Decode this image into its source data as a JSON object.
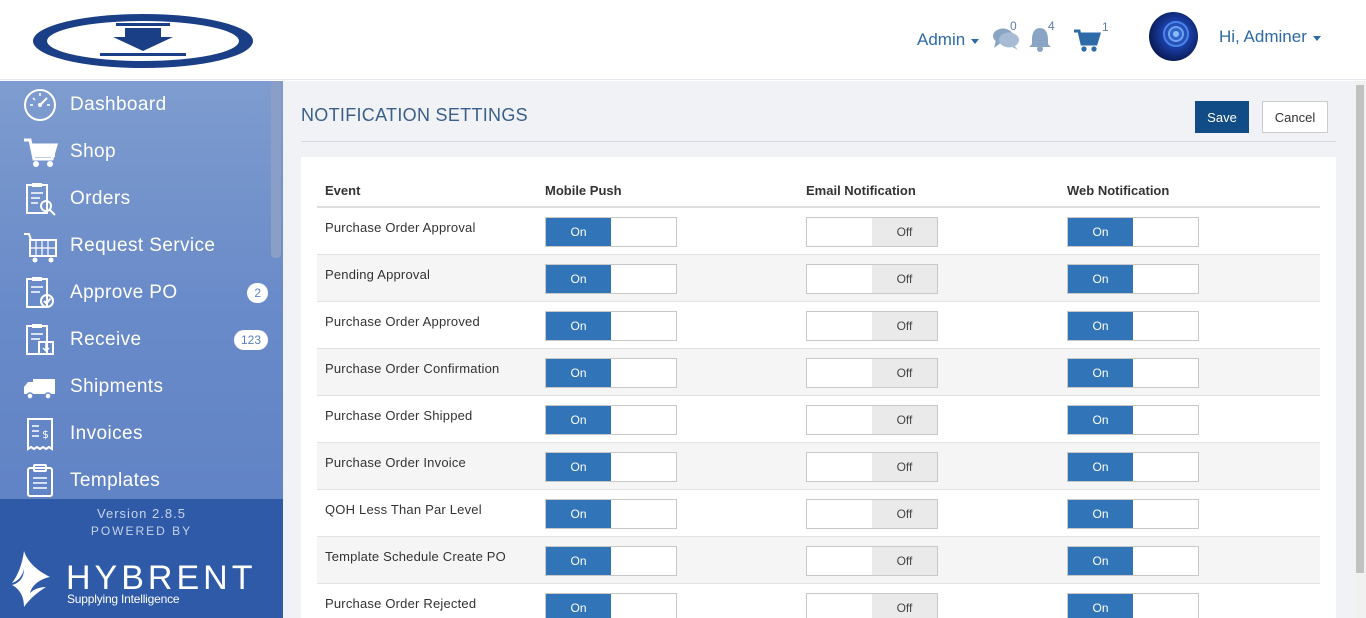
{
  "header": {
    "admin_menu": "Admin",
    "messages_count": "0",
    "notifications_count": "4",
    "cart_count": "1",
    "greeting": "Hi, Adminer"
  },
  "sidebar": {
    "items": [
      {
        "label": "Dashboard",
        "icon": "dashboard-icon"
      },
      {
        "label": "Shop",
        "icon": "cart-icon"
      },
      {
        "label": "Orders",
        "icon": "orders-icon"
      },
      {
        "label": "Request Service",
        "icon": "request-service-icon"
      },
      {
        "label": "Approve PO",
        "icon": "approve-po-icon",
        "badge": "2"
      },
      {
        "label": "Receive",
        "icon": "receive-icon",
        "badge": "123"
      },
      {
        "label": "Shipments",
        "icon": "truck-icon"
      },
      {
        "label": "Invoices",
        "icon": "invoice-icon"
      },
      {
        "label": "Templates",
        "icon": "clipboard-icon"
      }
    ],
    "version": "Version 2.8.5",
    "powered_by": "POWERED BY",
    "brand_name": "HYBRENT",
    "brand_tagline": "Supplying Intelligence"
  },
  "page": {
    "title": "NOTIFICATION SETTINGS",
    "save_label": "Save",
    "cancel_label": "Cancel"
  },
  "table": {
    "columns": [
      "Event",
      "Mobile Push",
      "Email Notification",
      "Web Notification"
    ],
    "on_label": "On",
    "off_label": "Off",
    "rows": [
      {
        "event": "Purchase Order Approval",
        "mobile": "On",
        "email": "Off",
        "web": "On"
      },
      {
        "event": "Pending Approval",
        "mobile": "On",
        "email": "Off",
        "web": "On"
      },
      {
        "event": "Purchase Order Approved",
        "mobile": "On",
        "email": "Off",
        "web": "On"
      },
      {
        "event": "Purchase Order Confirmation",
        "mobile": "On",
        "email": "Off",
        "web": "On"
      },
      {
        "event": "Purchase Order Shipped",
        "mobile": "On",
        "email": "Off",
        "web": "On"
      },
      {
        "event": "Purchase Order Invoice",
        "mobile": "On",
        "email": "Off",
        "web": "On"
      },
      {
        "event": "QOH Less Than Par Level",
        "mobile": "On",
        "email": "Off",
        "web": "On"
      },
      {
        "event": "Template Schedule Create PO",
        "mobile": "On",
        "email": "Off",
        "web": "On"
      },
      {
        "event": "Purchase Order Rejected",
        "mobile": "On",
        "email": "Off",
        "web": "On"
      }
    ]
  },
  "colors": {
    "toggle_on": "#3175b8",
    "toggle_off": "#eaeaea",
    "save_button": "#114c86",
    "sidebar": "#6a8bc9",
    "sidebar_footer": "#2e5aa8"
  }
}
